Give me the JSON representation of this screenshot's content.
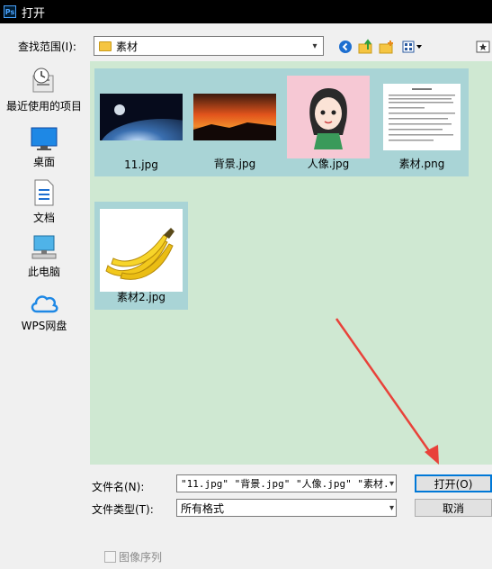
{
  "window": {
    "title": "打开",
    "app_icon": "Ps"
  },
  "lookin": {
    "label": "查找范围(I):",
    "value": "素材"
  },
  "toolbar": {
    "icons": [
      "back-icon",
      "up-folder-icon",
      "new-folder-icon",
      "view-menu-icon"
    ]
  },
  "places": [
    {
      "label": "最近使用的项目",
      "icon": "recent-icon"
    },
    {
      "label": "桌面",
      "icon": "desktop-icon"
    },
    {
      "label": "文档",
      "icon": "documents-icon"
    },
    {
      "label": "此电脑",
      "icon": "computer-icon"
    },
    {
      "label": "WPS网盘",
      "icon": "cloud-icon"
    }
  ],
  "files": [
    {
      "name": "11.jpg",
      "selected": true
    },
    {
      "name": "背景.jpg",
      "selected": true
    },
    {
      "name": "人像.jpg",
      "selected": true
    },
    {
      "name": "素材.png",
      "selected": true
    },
    {
      "name": "素材2.jpg",
      "selected": true
    }
  ],
  "filename": {
    "label": "文件名(N):",
    "value": "\"11.jpg\" \"背景.jpg\" \"人像.jpg\" \"素材."
  },
  "filetype": {
    "label": "文件类型(T):",
    "value": "所有格式"
  },
  "buttons": {
    "open": "打开(O)",
    "cancel": "取消"
  },
  "image_sequence": {
    "label": "图像序列",
    "checked": false
  },
  "colors": {
    "file_area": "#cfe8d2",
    "selected_tile": "#a9d4d6",
    "accent": "#0078d7",
    "annotation_arrow": "#e8423a"
  }
}
